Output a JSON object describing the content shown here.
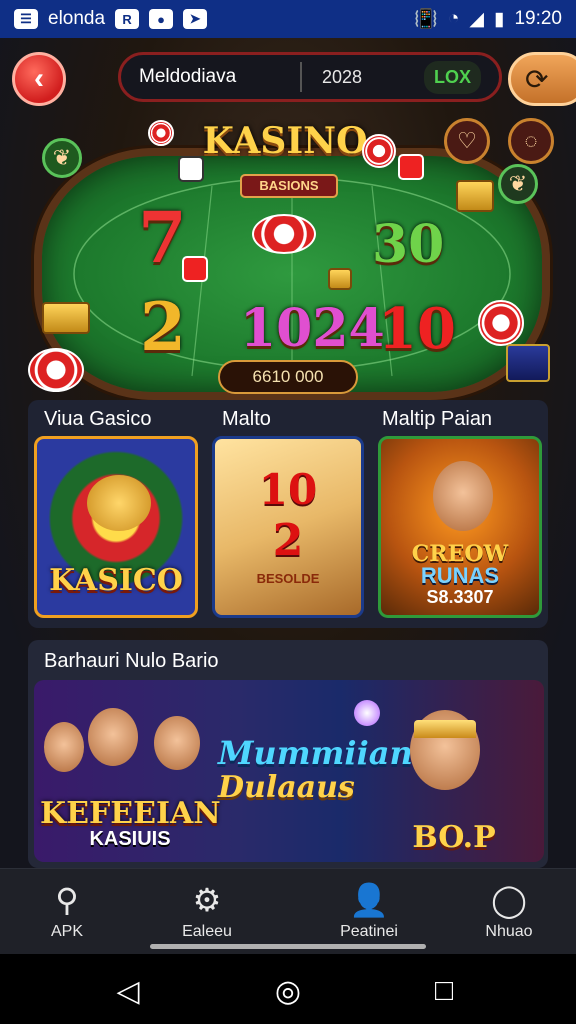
{
  "status_bar": {
    "app_label": "elonda",
    "time": "19:20"
  },
  "header": {
    "title": "Meldodiava",
    "balance": "2028",
    "badge": "LOX"
  },
  "table": {
    "title": "KASINO",
    "subtitle": "BASIONS",
    "numbers": [
      "7",
      "30",
      "2",
      "1024",
      "10"
    ],
    "base_value": "6610 000"
  },
  "section1": {
    "labels": [
      "Viua Gasico",
      "Malto",
      "Maltip Paian"
    ],
    "cards": [
      {
        "title": "KASICO"
      },
      {
        "big": "10",
        "mid": "2",
        "small": "BESOLDE"
      },
      {
        "line1": "CREOW",
        "line2": "RUNAS",
        "line3": "S8.3307"
      }
    ]
  },
  "section2": {
    "label": "Barhauri Nulo Bario",
    "banner_left_line1": "KEFEEIAN",
    "banner_left_line2": "KASIUIS",
    "banner_mid_line1": "Mummiian",
    "banner_mid_line2": "Dulaaus",
    "banner_right": "BO.P"
  },
  "bottom_nav": [
    {
      "icon": "search-icon",
      "label": "APK"
    },
    {
      "icon": "gear-icon",
      "label": "Ealeeu"
    },
    {
      "icon": "user-icon",
      "label": "Peatinei"
    },
    {
      "icon": "chat-icon",
      "label": "Nhuao"
    }
  ],
  "colors": {
    "status_bar": "#0f2f86",
    "accent_red": "#d11e1e",
    "felt_green": "#1d7a2d",
    "gold": "#ffd24a"
  }
}
